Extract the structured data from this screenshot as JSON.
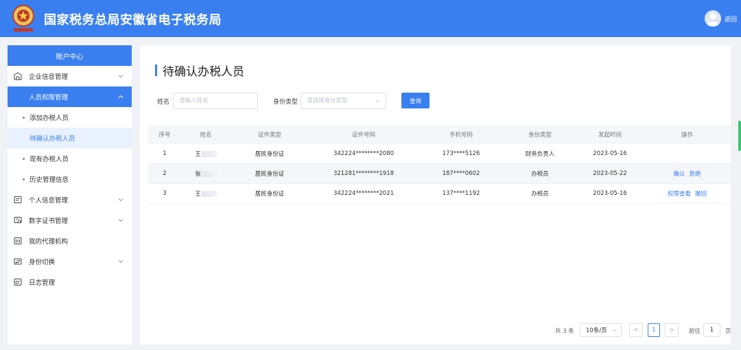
{
  "header": {
    "title": "国家税务总局安徽省电子税务局",
    "back_label": "返回"
  },
  "sidebar": {
    "heading": "账户中心",
    "items": [
      {
        "label": "企业信息管理",
        "icon": "building-icon",
        "expanded": false
      },
      {
        "label": "人员权限管理",
        "icon": "",
        "expanded": true
      },
      {
        "label": "个人信息管理",
        "icon": "id-card-icon",
        "expanded": false
      },
      {
        "label": "数字证书管理",
        "icon": "certificate-icon",
        "expanded": false
      },
      {
        "label": "我的代理机构",
        "icon": "agency-icon"
      },
      {
        "label": "身份切换",
        "icon": "switch-icon",
        "expanded": false
      },
      {
        "label": "日志管理",
        "icon": "log-icon"
      }
    ],
    "sub_items": [
      {
        "label": "添加办税人员"
      },
      {
        "label": "待确认办税人员",
        "selected": true
      },
      {
        "label": "现有办税人员"
      },
      {
        "label": "历史管理信息"
      }
    ]
  },
  "main": {
    "title": "待确认办税人员",
    "filters": {
      "name_label": "姓名",
      "name_placeholder": "请输入姓名",
      "type_label": "身份类型",
      "type_placeholder": "请选择身份类型",
      "query_label": "查询"
    },
    "table": {
      "headers": [
        "序号",
        "姓名",
        "证件类型",
        "证件号码",
        "手机号码",
        "身份类型",
        "发起时间",
        "操作"
      ],
      "rows": [
        {
          "index": "1",
          "name": "王",
          "id_type": "居民身份证",
          "id_number": "342224********2080",
          "phone": "173****5126",
          "role": "财务负责人",
          "date": "2023-05-16",
          "actions": []
        },
        {
          "index": "2",
          "name": "张",
          "id_type": "居民身份证",
          "id_number": "321281********1918",
          "phone": "187****0602",
          "role": "办税员",
          "date": "2023-05-22",
          "actions": [
            "确认",
            "拒绝"
          ]
        },
        {
          "index": "3",
          "name": "王",
          "id_type": "居民身份证",
          "id_number": "342224********2021",
          "phone": "137****1192",
          "role": "办税员",
          "date": "2023-05-16",
          "actions": [
            "权限查看",
            "撤回"
          ]
        }
      ]
    },
    "pagination": {
      "total_label": "共 3 条",
      "page_size": "10条/页",
      "prev": "<",
      "current_page": "1",
      "next": ">",
      "goto_label": "前往",
      "goto_value": "1",
      "page_suffix": "页"
    }
  },
  "colors": {
    "accent": "#3a7ff0",
    "selected_bg": "#e8f1fd"
  }
}
